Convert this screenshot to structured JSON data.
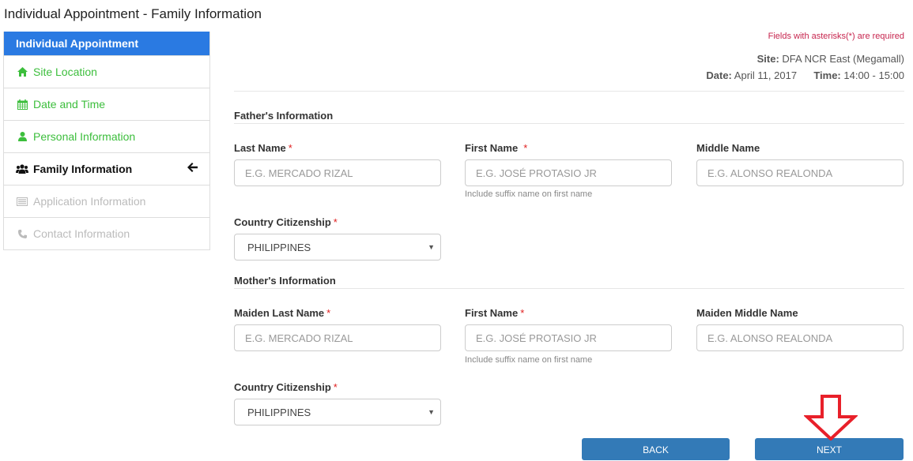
{
  "page_title": "Individual Appointment - Family Information",
  "sidebar": {
    "header": "Individual Appointment",
    "items": [
      {
        "label": "Site Location",
        "icon": "home-icon",
        "state": "done"
      },
      {
        "label": "Date and Time",
        "icon": "calendar-icon",
        "state": "done"
      },
      {
        "label": "Personal Information",
        "icon": "user-icon",
        "state": "done"
      },
      {
        "label": "Family Information",
        "icon": "users-icon",
        "state": "active"
      },
      {
        "label": "Application Information",
        "icon": "list-icon",
        "state": "disabled"
      },
      {
        "label": "Contact Information",
        "icon": "phone-icon",
        "state": "disabled"
      }
    ],
    "active_indicator": "arrow-left-icon"
  },
  "info": {
    "required_note": "Fields with asterisks(*) are required",
    "site_label": "Site:",
    "site_value": "DFA NCR East (Megamall)",
    "date_label": "Date:",
    "date_value": "April 11, 2017",
    "time_label": "Time:",
    "time_value": "14:00 - 15:00"
  },
  "father": {
    "section_title": "Father's Information",
    "last_name": {
      "label": "Last Name",
      "required_mark": "*",
      "placeholder": "E.G. MERCADO RIZAL",
      "value": ""
    },
    "first_name": {
      "label": "First Name",
      "required_mark": "*",
      "placeholder": "E.G. JOSÉ PROTASIO JR",
      "value": "",
      "help": "Include suffix name on first name"
    },
    "middle_name": {
      "label": "Middle Name",
      "placeholder": "E.G. ALONSO REALONDA",
      "value": ""
    },
    "citizenship": {
      "label": "Country Citizenship",
      "required_mark": "*",
      "selected": "PHILIPPINES"
    }
  },
  "mother": {
    "section_title": "Mother's Information",
    "last_name": {
      "label": "Maiden Last Name",
      "required_mark": "*",
      "placeholder": "E.G. MERCADO RIZAL",
      "value": ""
    },
    "first_name": {
      "label": "First Name",
      "required_mark": "*",
      "placeholder": "E.G. JOSÉ PROTASIO JR",
      "value": "",
      "help": "Include suffix name on first name"
    },
    "middle_name": {
      "label": "Maiden Middle Name",
      "placeholder": "E.G. ALONSO REALONDA",
      "value": ""
    },
    "citizenship": {
      "label": "Country Citizenship",
      "required_mark": "*",
      "selected": "PHILIPPINES"
    }
  },
  "buttons": {
    "back": "BACK",
    "next": "NEXT"
  },
  "colors": {
    "primary": "#337ab7",
    "sidebar_header": "#2a7ae2",
    "done": "#3cbe3c",
    "required": "#e02020",
    "annotation": "#e8202a"
  }
}
